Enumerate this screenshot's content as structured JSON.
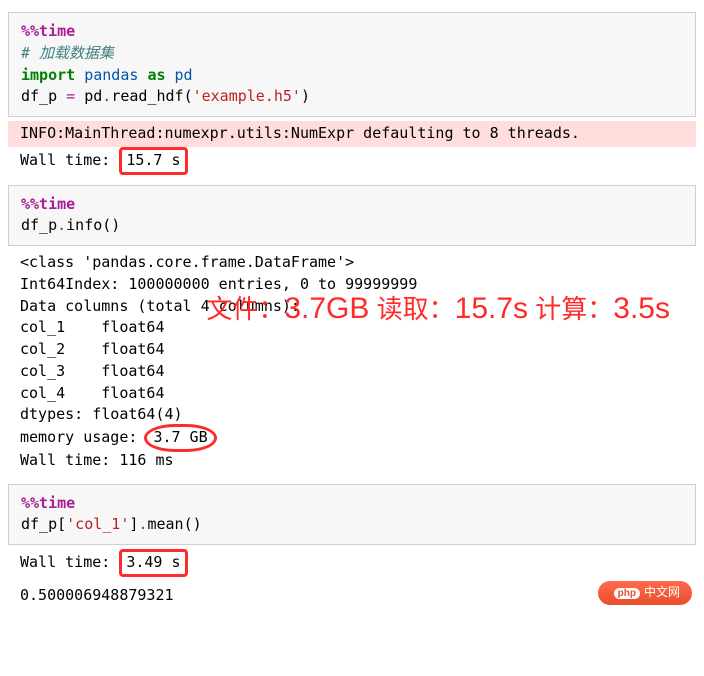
{
  "cell1": {
    "magic": "%%time",
    "comment": "# 加载数据集",
    "kw_import": "import",
    "mod": "pandas",
    "kw_as": "as",
    "alias": "pd",
    "assign_lhs": "df_p ",
    "op": "=",
    "assign_rhs_pre": " pd",
    "dot1": ".",
    "read": "read_hdf",
    "lpar": "(",
    "str": "'example.h5'",
    "rpar": ")"
  },
  "cell1_err": "INFO:MainThread:numexpr.utils:NumExpr defaulting to 8 threads.",
  "cell1_wall_pre": "Wall time: ",
  "cell1_wall_val": "15.7 s",
  "cell2": {
    "magic": "%%time",
    "obj": "df_p",
    "dot": ".",
    "fn": "info",
    "call": "()"
  },
  "info_out": {
    "l1": "<class 'pandas.core.frame.DataFrame'>",
    "l2": "Int64Index: 100000000 entries, 0 to 99999999",
    "l3": "Data columns (total 4 columns):",
    "c1": "col_1    float64",
    "c2": "col_2    float64",
    "c3": "col_3    float64",
    "c4": "col_4    float64",
    "dt": "dtypes: float64(4)",
    "mem_pre": "memory usage: ",
    "mem_val": "3.7 GB",
    "wall": "Wall time: 116 ms"
  },
  "annot": {
    "r1a": "文件：",
    "r1b": "3.7GB",
    "r2a": "读取：",
    "r2b": "15.7s",
    "r3a": "计算：",
    "r3b": "3.5s"
  },
  "cell3": {
    "magic": "%%time",
    "obj": "df_p",
    "br_l": "[",
    "key": "'col_1'",
    "br_r": "]",
    "dot": ".",
    "fn": "mean",
    "call": "()"
  },
  "cell3_wall_pre": "Wall time: ",
  "cell3_wall_val": "3.49 s",
  "cell3_result": "0.500006948879321",
  "watermark": "中文网"
}
